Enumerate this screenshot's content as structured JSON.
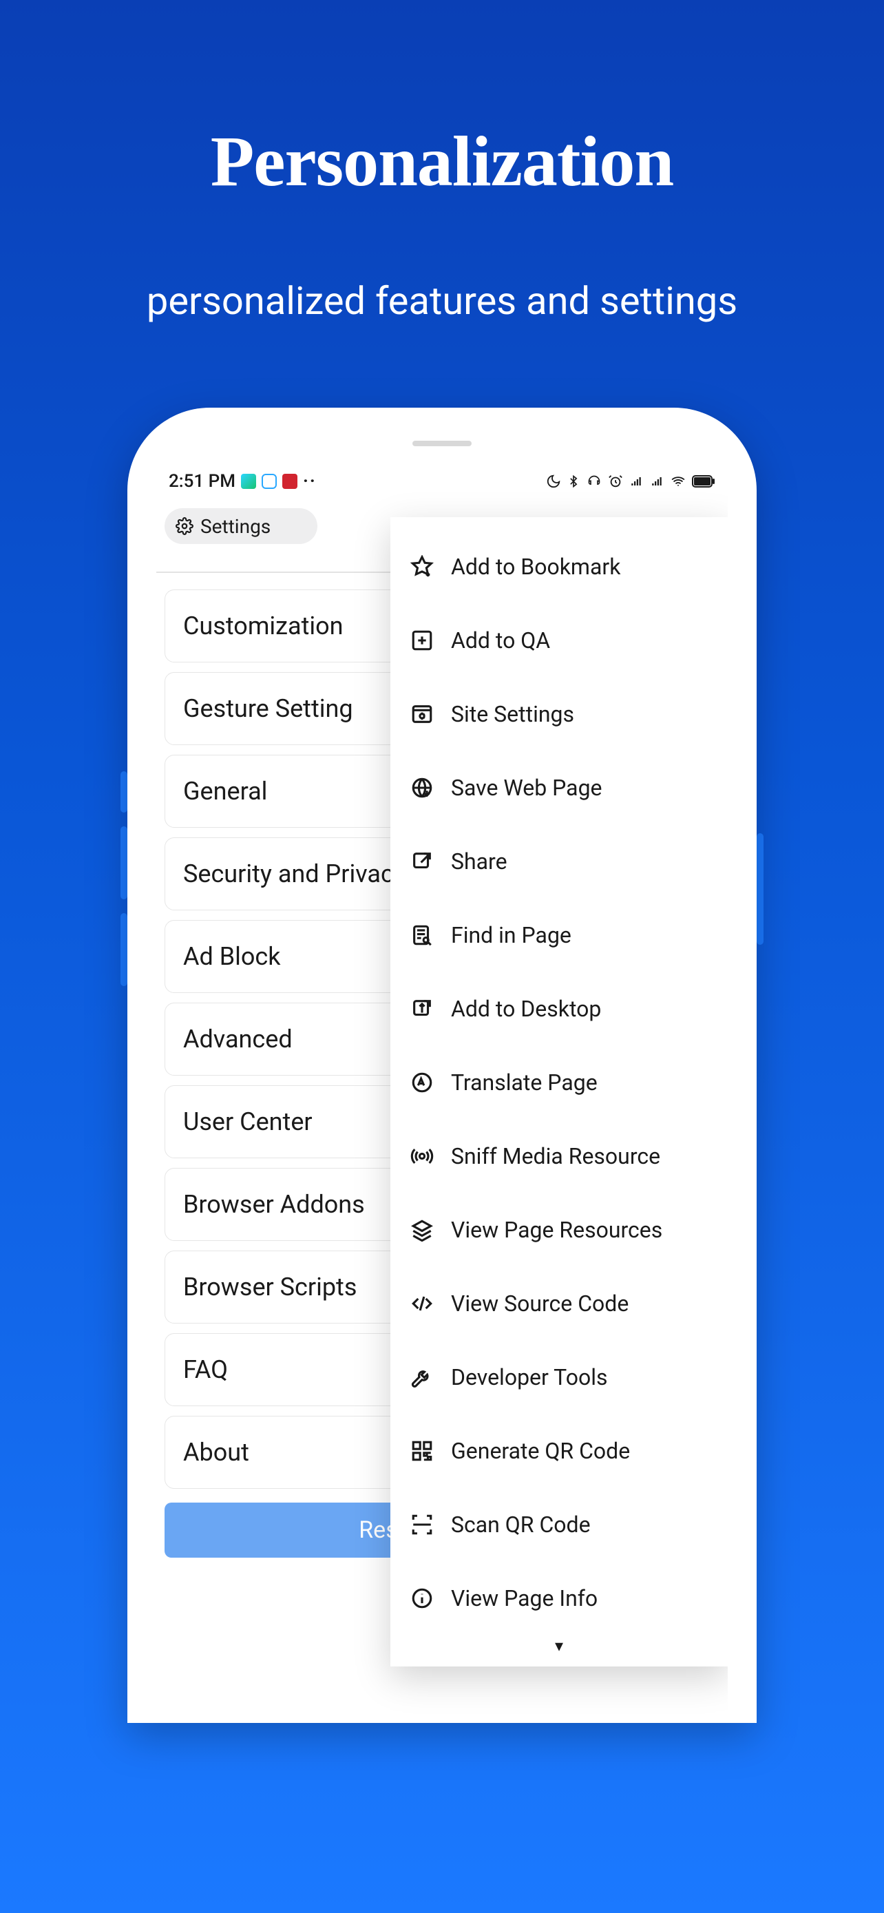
{
  "hero": {
    "title": "Personalization",
    "subtitle": "personalized features and settings"
  },
  "statusbar": {
    "time": "2:51 PM",
    "dots": "··"
  },
  "settings_header": {
    "label": "Settings"
  },
  "settings_items": [
    "Customization",
    "Gesture Setting",
    "General",
    "Security and Privacy",
    "Ad Block",
    "Advanced",
    "User Center",
    "Browser Addons",
    "Browser Scripts",
    "FAQ",
    "About"
  ],
  "reset_label": "Reset to Default",
  "menu_items": [
    {
      "icon": "star-plus-icon",
      "label": "Add to Bookmark"
    },
    {
      "icon": "plus-square-icon",
      "label": "Add to QA"
    },
    {
      "icon": "site-settings-icon",
      "label": "Site Settings"
    },
    {
      "icon": "save-page-icon",
      "label": "Save Web Page"
    },
    {
      "icon": "share-icon",
      "label": "Share"
    },
    {
      "icon": "find-icon",
      "label": "Find in Page"
    },
    {
      "icon": "desktop-icon",
      "label": "Add to Desktop"
    },
    {
      "icon": "translate-icon",
      "label": "Translate Page"
    },
    {
      "icon": "radio-icon",
      "label": "Sniff Media Resource"
    },
    {
      "icon": "layers-icon",
      "label": "View Page Resources"
    },
    {
      "icon": "code-icon",
      "label": "View Source Code"
    },
    {
      "icon": "devtools-icon",
      "label": "Developer Tools"
    },
    {
      "icon": "qr-generate-icon",
      "label": "Generate QR Code"
    },
    {
      "icon": "qr-scan-icon",
      "label": "Scan QR Code"
    },
    {
      "icon": "info-icon",
      "label": "View Page Info"
    }
  ],
  "menu_more": "▾"
}
